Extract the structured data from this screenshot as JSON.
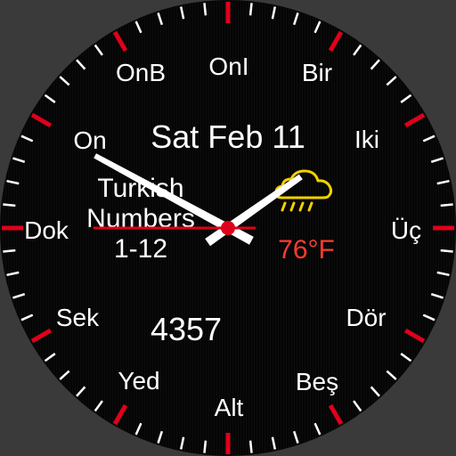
{
  "watch_face": {
    "hour_labels": [
      {
        "hour": 1,
        "label": "Bir"
      },
      {
        "hour": 2,
        "label": "Iki"
      },
      {
        "hour": 3,
        "label": "Üç"
      },
      {
        "hour": 4,
        "label": "Dör"
      },
      {
        "hour": 5,
        "label": "Beş"
      },
      {
        "hour": 6,
        "label": "Alt"
      },
      {
        "hour": 7,
        "label": "Yed"
      },
      {
        "hour": 8,
        "label": "Sek"
      },
      {
        "hour": 9,
        "label": "Dok"
      },
      {
        "hour": 10,
        "label": "On"
      },
      {
        "hour": 11,
        "label": "OnB"
      },
      {
        "hour": 12,
        "label": "OnI"
      }
    ],
    "date": "Sat Feb 11",
    "title_lines": [
      "Turkish",
      "Numbers",
      "1-12"
    ],
    "temperature": "76°F",
    "steps": "4357",
    "weather_icon": "cloud-rain-icon",
    "time": {
      "hours": 1,
      "minutes": 49,
      "seconds": 45
    },
    "colors": {
      "background": "#050505",
      "text": "#ffffff",
      "accent": "#e0001b",
      "temperature": "#ff3b30",
      "weather_icon": "#f0d000"
    }
  }
}
